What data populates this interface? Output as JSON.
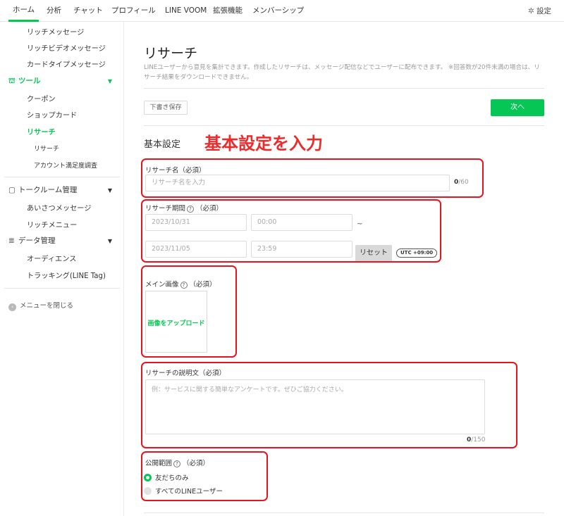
{
  "topnav": {
    "tabs": [
      "ホーム",
      "分析",
      "チャット",
      "プロフィール",
      "LINE VOOM",
      "拡張機能",
      "メンバーシップ"
    ],
    "settings": "設定"
  },
  "sidebar": {
    "items_top": [
      "リッチメッセージ",
      "リッチビデオメッセージ",
      "カードタイプメッセージ"
    ],
    "tools": {
      "label": "ツール",
      "items": [
        "クーポン",
        "ショップカード",
        "リサーチ"
      ],
      "sub_items": [
        "リサーチ",
        "アカウント満足度調査"
      ]
    },
    "talkroom": {
      "label": "トークルーム管理",
      "items": [
        "あいさつメッセージ",
        "リッチメニュー"
      ]
    },
    "data": {
      "label": "データ管理",
      "items": [
        "オーディエンス",
        "トラッキング(LINE Tag)"
      ]
    },
    "collapse": "メニューを閉じる"
  },
  "main": {
    "title": "リサーチ",
    "description": "LINEユーザーから意見を集計できます。作成したリサーチは、メッセージ配信などでユーザーに配布できます。 ※回答数が20件未満の場合は、リサーチ結果をダウンロードできません。",
    "draft_button": "下書き保存",
    "next_button": "次へ",
    "section_title": "基本設定",
    "annotation": "基本設定を入力",
    "name": {
      "label": "リサーチ名（必須）",
      "placeholder": "リサーチ名を入力",
      "count": "0",
      "max": "/60"
    },
    "period": {
      "label": "リサーチ期間",
      "required": "（必須）",
      "start_date": "2023/10/31",
      "start_time": "00:00",
      "tilde": "~",
      "end_date": "2023/11/05",
      "end_time": "23:59",
      "reset_button": "リセット",
      "timezone": "UTC +09:00"
    },
    "image": {
      "label": "メイン画像",
      "required": "（必須）",
      "upload": "画像をアップロード"
    },
    "description_field": {
      "label": "リサーチの説明文（必須）",
      "placeholder": "例：サービスに関する簡単なアンケートです。ぜひご協力ください。",
      "count": "0",
      "max": "/150"
    },
    "visibility": {
      "label": "公開範囲",
      "required": "（必須）",
      "options": [
        "友だちのみ",
        "すべてのLINEユーザー"
      ],
      "selected": "友だちのみ"
    }
  },
  "colors": {
    "accent": "#06c755",
    "annotation": "#e5141e"
  }
}
